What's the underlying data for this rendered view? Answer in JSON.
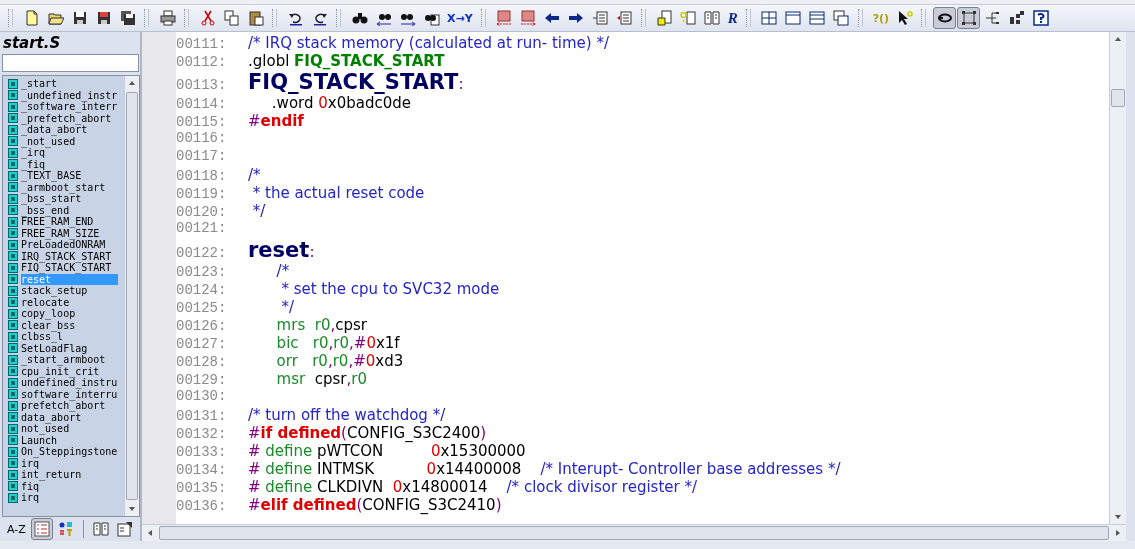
{
  "toolbar": [
    [
      {
        "kind": "new",
        "pressed": false
      },
      {
        "kind": "open",
        "pressed": false
      },
      {
        "kind": "save",
        "pressed": false
      },
      {
        "kind": "save-as",
        "pressed": false
      },
      {
        "kind": "save-all",
        "pressed": false
      }
    ],
    [
      {
        "kind": "print",
        "pressed": false
      }
    ],
    [
      {
        "kind": "cut",
        "pressed": false
      },
      {
        "kind": "copy",
        "pressed": false
      },
      {
        "kind": "paste",
        "pressed": false
      }
    ],
    [
      {
        "kind": "undo",
        "pressed": false
      },
      {
        "kind": "redo",
        "pressed": false
      }
    ],
    [
      {
        "kind": "find",
        "pressed": false
      },
      {
        "kind": "find-prev",
        "pressed": false
      },
      {
        "kind": "find-next",
        "pressed": false
      },
      {
        "kind": "find-files",
        "pressed": false
      },
      {
        "kind": "replace",
        "label": "X→Y",
        "pressed": false
      }
    ],
    [
      {
        "kind": "mark-prev",
        "pressed": false
      },
      {
        "kind": "mark-next",
        "pressed": false
      },
      {
        "kind": "back",
        "pressed": false
      },
      {
        "kind": "forward",
        "pressed": false
      },
      {
        "kind": "outdent",
        "pressed": false
      },
      {
        "kind": "indent",
        "pressed": false
      }
    ],
    [
      {
        "kind": "hand",
        "pressed": false
      },
      {
        "kind": "query",
        "pressed": false
      },
      {
        "kind": "book",
        "pressed": false
      },
      {
        "kind": "logo",
        "label": "R",
        "pressed": false
      }
    ],
    [
      {
        "kind": "tile",
        "pressed": false
      },
      {
        "kind": "panel",
        "pressed": false
      },
      {
        "kind": "split",
        "pressed": false
      },
      {
        "kind": "cascade",
        "pressed": false
      }
    ],
    [
      {
        "kind": "call",
        "label": "?()",
        "pressed": false
      },
      {
        "kind": "pointer",
        "pressed": false
      }
    ],
    [
      {
        "kind": "loop",
        "pressed": true
      },
      {
        "kind": "frame",
        "pressed": true
      },
      {
        "kind": "tree",
        "pressed": false
      },
      {
        "kind": "blocks",
        "pressed": false
      },
      {
        "kind": "help",
        "pressed": false
      }
    ]
  ],
  "sidebar": {
    "title": "start.S",
    "symbols": [
      {
        "name": "_start",
        "selected": false
      },
      {
        "name": "_undefined_instr",
        "selected": false
      },
      {
        "name": "_software_interr",
        "selected": false
      },
      {
        "name": "_prefetch_abort",
        "selected": false
      },
      {
        "name": "_data_abort",
        "selected": false
      },
      {
        "name": "_not_used",
        "selected": false
      },
      {
        "name": "_irq",
        "selected": false
      },
      {
        "name": "_fiq",
        "selected": false
      },
      {
        "name": "_TEXT_BASE",
        "selected": false
      },
      {
        "name": "_armboot_start",
        "selected": false
      },
      {
        "name": "_bss_start",
        "selected": false
      },
      {
        "name": "_bss_end",
        "selected": false
      },
      {
        "name": "FREE_RAM_END",
        "selected": false
      },
      {
        "name": "FREE_RAM_SIZE",
        "selected": false
      },
      {
        "name": "PreLoadedONRAM",
        "selected": false
      },
      {
        "name": "IRQ_STACK_START",
        "selected": false
      },
      {
        "name": "FIQ_STACK_START",
        "selected": false
      },
      {
        "name": "reset",
        "selected": true
      },
      {
        "name": "stack_setup",
        "selected": false
      },
      {
        "name": "relocate",
        "selected": false
      },
      {
        "name": "copy_loop",
        "selected": false
      },
      {
        "name": "clear_bss",
        "selected": false
      },
      {
        "name": "clbss_l",
        "selected": false
      },
      {
        "name": "SetLoadFlag",
        "selected": false
      },
      {
        "name": "_start_armboot",
        "selected": false
      },
      {
        "name": "cpu_init_crit",
        "selected": false
      },
      {
        "name": "undefined_instru",
        "selected": false
      },
      {
        "name": "software_interru",
        "selected": false
      },
      {
        "name": "prefetch_abort",
        "selected": false
      },
      {
        "name": "data_abort",
        "selected": false
      },
      {
        "name": "not_used",
        "selected": false
      },
      {
        "name": "Launch",
        "selected": false
      },
      {
        "name": "On_Steppingstone",
        "selected": false
      },
      {
        "name": "irq",
        "selected": false
      },
      {
        "name": "int_return",
        "selected": false
      },
      {
        "name": "fiq",
        "selected": false
      },
      {
        "name": "irq",
        "selected": false
      }
    ],
    "tabs": [
      {
        "kind": "text",
        "label": "A-Z",
        "selected": false
      },
      {
        "kind": "list",
        "selected": true
      },
      {
        "kind": "categories",
        "selected": false
      },
      {
        "kind": "book",
        "selected": false
      },
      {
        "kind": "properties",
        "selected": false
      }
    ]
  },
  "code": [
    {
      "num": "00111:",
      "tokens": [
        {
          "kind": "cmt",
          "text": "/* IRQ stack memory (calculated at run- time) */"
        }
      ]
    },
    {
      "num": "00112:",
      "tokens": [
        {
          "kind": "plain",
          "text": ".globl "
        },
        {
          "kind": "sym",
          "text": "FIQ_STACK_START"
        }
      ]
    },
    {
      "num": "00113:",
      "tokens": [
        {
          "kind": "label",
          "text": "FIQ_STACK_START"
        },
        {
          "kind": "punct",
          "text": ":"
        }
      ]
    },
    {
      "num": "00114:",
      "tokens": [
        {
          "kind": "plain",
          "text": "     .word "
        },
        {
          "kind": "zero",
          "text": "0"
        },
        {
          "kind": "plain",
          "text": "x0badc0de"
        }
      ]
    },
    {
      "num": "00115:",
      "tokens": [
        {
          "kind": "punct",
          "text": "#"
        },
        {
          "kind": "kw",
          "text": "endif"
        }
      ]
    },
    {
      "num": "00116:"
    },
    {
      "num": "00117:"
    },
    {
      "num": "00118:",
      "tokens": [
        {
          "kind": "cmt",
          "text": "/*"
        }
      ]
    },
    {
      "num": "00119:",
      "tokens": [
        {
          "kind": "cmt",
          "text": " * the actual reset code"
        }
      ]
    },
    {
      "num": "00120:",
      "tokens": [
        {
          "kind": "cmt",
          "text": " */"
        }
      ]
    },
    {
      "num": "00121:"
    },
    {
      "num": "00122:",
      "tokens": [
        {
          "kind": "label",
          "text": "reset"
        },
        {
          "kind": "punct",
          "text": ":"
        }
      ]
    },
    {
      "num": "00123:",
      "tokens": [
        {
          "kind": "cmt",
          "text": "      /*"
        }
      ]
    },
    {
      "num": "00124:",
      "tokens": [
        {
          "kind": "cmt",
          "text": "       * set the cpu to SVC32 mode"
        }
      ]
    },
    {
      "num": "00125:",
      "tokens": [
        {
          "kind": "cmt",
          "text": "       */"
        }
      ]
    },
    {
      "num": "00126:",
      "tokens": [
        {
          "kind": "instr",
          "text": "      mrs  r0"
        },
        {
          "kind": "punct",
          "text": ","
        },
        {
          "kind": "plain",
          "text": "cpsr"
        }
      ]
    },
    {
      "num": "00127:",
      "tokens": [
        {
          "kind": "instr",
          "text": "      bic   r0"
        },
        {
          "kind": "punct",
          "text": ","
        },
        {
          "kind": "instr",
          "text": "r0"
        },
        {
          "kind": "punct",
          "text": ",#"
        },
        {
          "kind": "zero",
          "text": "0"
        },
        {
          "kind": "plain",
          "text": "x1f"
        }
      ]
    },
    {
      "num": "00128:",
      "tokens": [
        {
          "kind": "instr",
          "text": "      orr   r0"
        },
        {
          "kind": "punct",
          "text": ","
        },
        {
          "kind": "instr",
          "text": "r0"
        },
        {
          "kind": "punct",
          "text": ",#"
        },
        {
          "kind": "zero",
          "text": "0"
        },
        {
          "kind": "plain",
          "text": "xd3"
        }
      ]
    },
    {
      "num": "00129:",
      "tokens": [
        {
          "kind": "instr",
          "text": "      msr  "
        },
        {
          "kind": "plain",
          "text": "cpsr"
        },
        {
          "kind": "punct",
          "text": ","
        },
        {
          "kind": "instr",
          "text": "r0"
        }
      ]
    },
    {
      "num": "00130:"
    },
    {
      "num": "00131:",
      "tokens": [
        {
          "kind": "cmt",
          "text": "/* turn off the watchdog */"
        }
      ]
    },
    {
      "num": "00132:",
      "tokens": [
        {
          "kind": "punct",
          "text": "#"
        },
        {
          "kind": "kw",
          "text": "if defined"
        },
        {
          "kind": "punct",
          "text": "("
        },
        {
          "kind": "plain",
          "text": "CONFIG_S3C2400"
        },
        {
          "kind": "punct",
          "text": ")"
        }
      ]
    },
    {
      "num": "00133:",
      "tokens": [
        {
          "kind": "punct",
          "text": "# "
        },
        {
          "kind": "instr",
          "text": "define"
        },
        {
          "kind": "plain",
          "text": " pWTCON          "
        },
        {
          "kind": "zero",
          "text": "0"
        },
        {
          "kind": "plain",
          "text": "x15300000"
        }
      ]
    },
    {
      "num": "00134:",
      "tokens": [
        {
          "kind": "punct",
          "text": "# "
        },
        {
          "kind": "instr",
          "text": "define"
        },
        {
          "kind": "plain",
          "text": " INTMSK           "
        },
        {
          "kind": "zero",
          "text": "0"
        },
        {
          "kind": "plain",
          "text": "x14400008    "
        },
        {
          "kind": "cmt",
          "text": "/* Interupt- Controller base addresses */"
        }
      ]
    },
    {
      "num": "00135:",
      "tokens": [
        {
          "kind": "punct",
          "text": "# "
        },
        {
          "kind": "instr",
          "text": "define"
        },
        {
          "kind": "plain",
          "text": " CLKDIVN  "
        },
        {
          "kind": "zero",
          "text": "0"
        },
        {
          "kind": "plain",
          "text": "x14800014    "
        },
        {
          "kind": "cmt",
          "text": "/* clock divisor register */"
        }
      ]
    },
    {
      "num": "00136:",
      "tokens": [
        {
          "kind": "punct",
          "text": "#"
        },
        {
          "kind": "kw",
          "text": "elif defined"
        },
        {
          "kind": "punct",
          "text": "("
        },
        {
          "kind": "plain",
          "text": "CONFIG_S3C2410"
        },
        {
          "kind": "punct",
          "text": ")"
        }
      ]
    }
  ]
}
